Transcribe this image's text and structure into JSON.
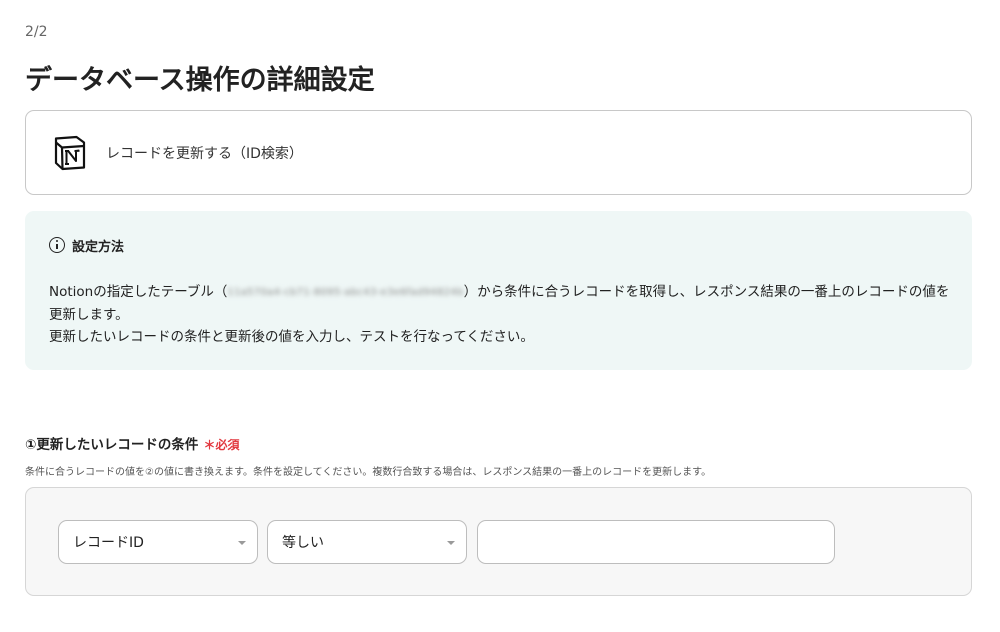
{
  "header": {
    "step": "2/2",
    "title": "データベース操作の詳細設定"
  },
  "action": {
    "icon": "notion-logo-icon",
    "label": "レコードを更新する（ID検索）"
  },
  "info": {
    "title": "設定方法",
    "body_prefix": "Notionの指定したテーブル（",
    "table_id_blurred": "11a570a4-cb71-8095-abc43-e3e6fad94824b",
    "body_suffix": "）から条件に合うレコードを取得し、レスポンス結果の一番上のレコードの値を更新します。",
    "body_line2": "更新したいレコードの条件と更新後の値を入力し、テストを行なってください。"
  },
  "condition": {
    "title": "①更新したいレコードの条件",
    "required_mark": "＊必須",
    "help": "条件に合うレコードの値を②の値に書き換えます。条件を設定してください。複数行合致する場合は、レスポンス結果の一番上のレコードを更新します。",
    "field_select": "レコードID",
    "operator_select": "等しい",
    "value": "",
    "value_placeholder": ""
  }
}
